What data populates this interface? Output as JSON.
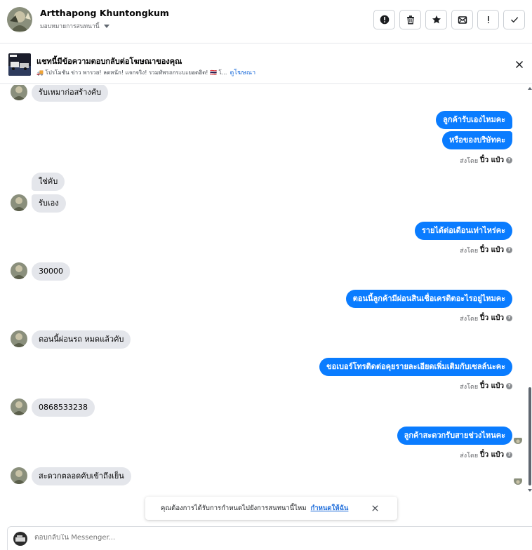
{
  "header": {
    "name": "Artthapong Khuntongkum",
    "assign_label": "มอบหมายการสนทนานี้",
    "actions": [
      {
        "icon": "alert-circle-icon",
        "glyph": "!"
      },
      {
        "icon": "trash-icon",
        "glyph": ""
      },
      {
        "icon": "star-icon",
        "glyph": ""
      },
      {
        "icon": "mark-unread-icon",
        "glyph": ""
      },
      {
        "icon": "exclamation-icon",
        "glyph": "!"
      },
      {
        "icon": "checkmark-icon",
        "glyph": ""
      }
    ]
  },
  "ad_banner": {
    "title": "แชทนี้มีข้อความตอบกลับต่อโฆษณาของคุณ",
    "description": "🚚 โปรโมชัน ข่าว พารวย! ลดหนัก! แจกจริง! รวมทัพรถกระบะยอดฮิต! 🇹🇭 โ...",
    "link": "ดูโฆษณา"
  },
  "messages": [
    {
      "dir": "in",
      "text": "รับเหมาก่อสร้างคับ",
      "avatar": true
    },
    {
      "dir": "out",
      "text": "ลูกค้ารับเองไหมคะ"
    },
    {
      "dir": "out",
      "text": "หรือของบริษัทคะ"
    },
    {
      "dir": "in",
      "text": "ใช่คับ",
      "avatar": false
    },
    {
      "dir": "in",
      "text": "รับเอง",
      "avatar": true
    },
    {
      "dir": "out",
      "text": "รายได้ต่อเดือนเท่าไหร่คะ"
    },
    {
      "dir": "in",
      "text": "30000",
      "avatar": true
    },
    {
      "dir": "out",
      "text": "ตอนนี้ลูกค้ามีผ่อนสินเชื่อเครดิตอะไรอยู่ไหมคะ"
    },
    {
      "dir": "in",
      "text": "ตอนนี้ผ่อนรถ หมดแล้วคับ",
      "avatar": true
    },
    {
      "dir": "out",
      "text": "ขอเบอร์โทรติดต่อคุยรายละเอียดเพิ่มเติมกับเซลล์นะคะ"
    },
    {
      "dir": "in",
      "text": "0868533238",
      "avatar": true
    },
    {
      "dir": "out",
      "text": "ลูกค้าสะดวกรับสายช่วงไหนคะ"
    },
    {
      "dir": "in",
      "text": "สะดวกตลอดคับเข้าถึงเย็น",
      "avatar": true
    }
  ],
  "sent_meta": {
    "prefix": "ส่งโดย",
    "sender": "ปิ๋ว แป๋ว",
    "help": "?"
  },
  "toast": {
    "text": "คุณต้องการได้รับการกำหนดไปยังการสนทนานี้ไหม",
    "link": "กำหนดให้ฉัน"
  },
  "composer": {
    "placeholder": "ตอบกลับใน Messenger..."
  },
  "colors": {
    "outgoing_bubble": "#0a7cff",
    "incoming_bubble": "#e4e6eb",
    "link": "#216fdb"
  }
}
